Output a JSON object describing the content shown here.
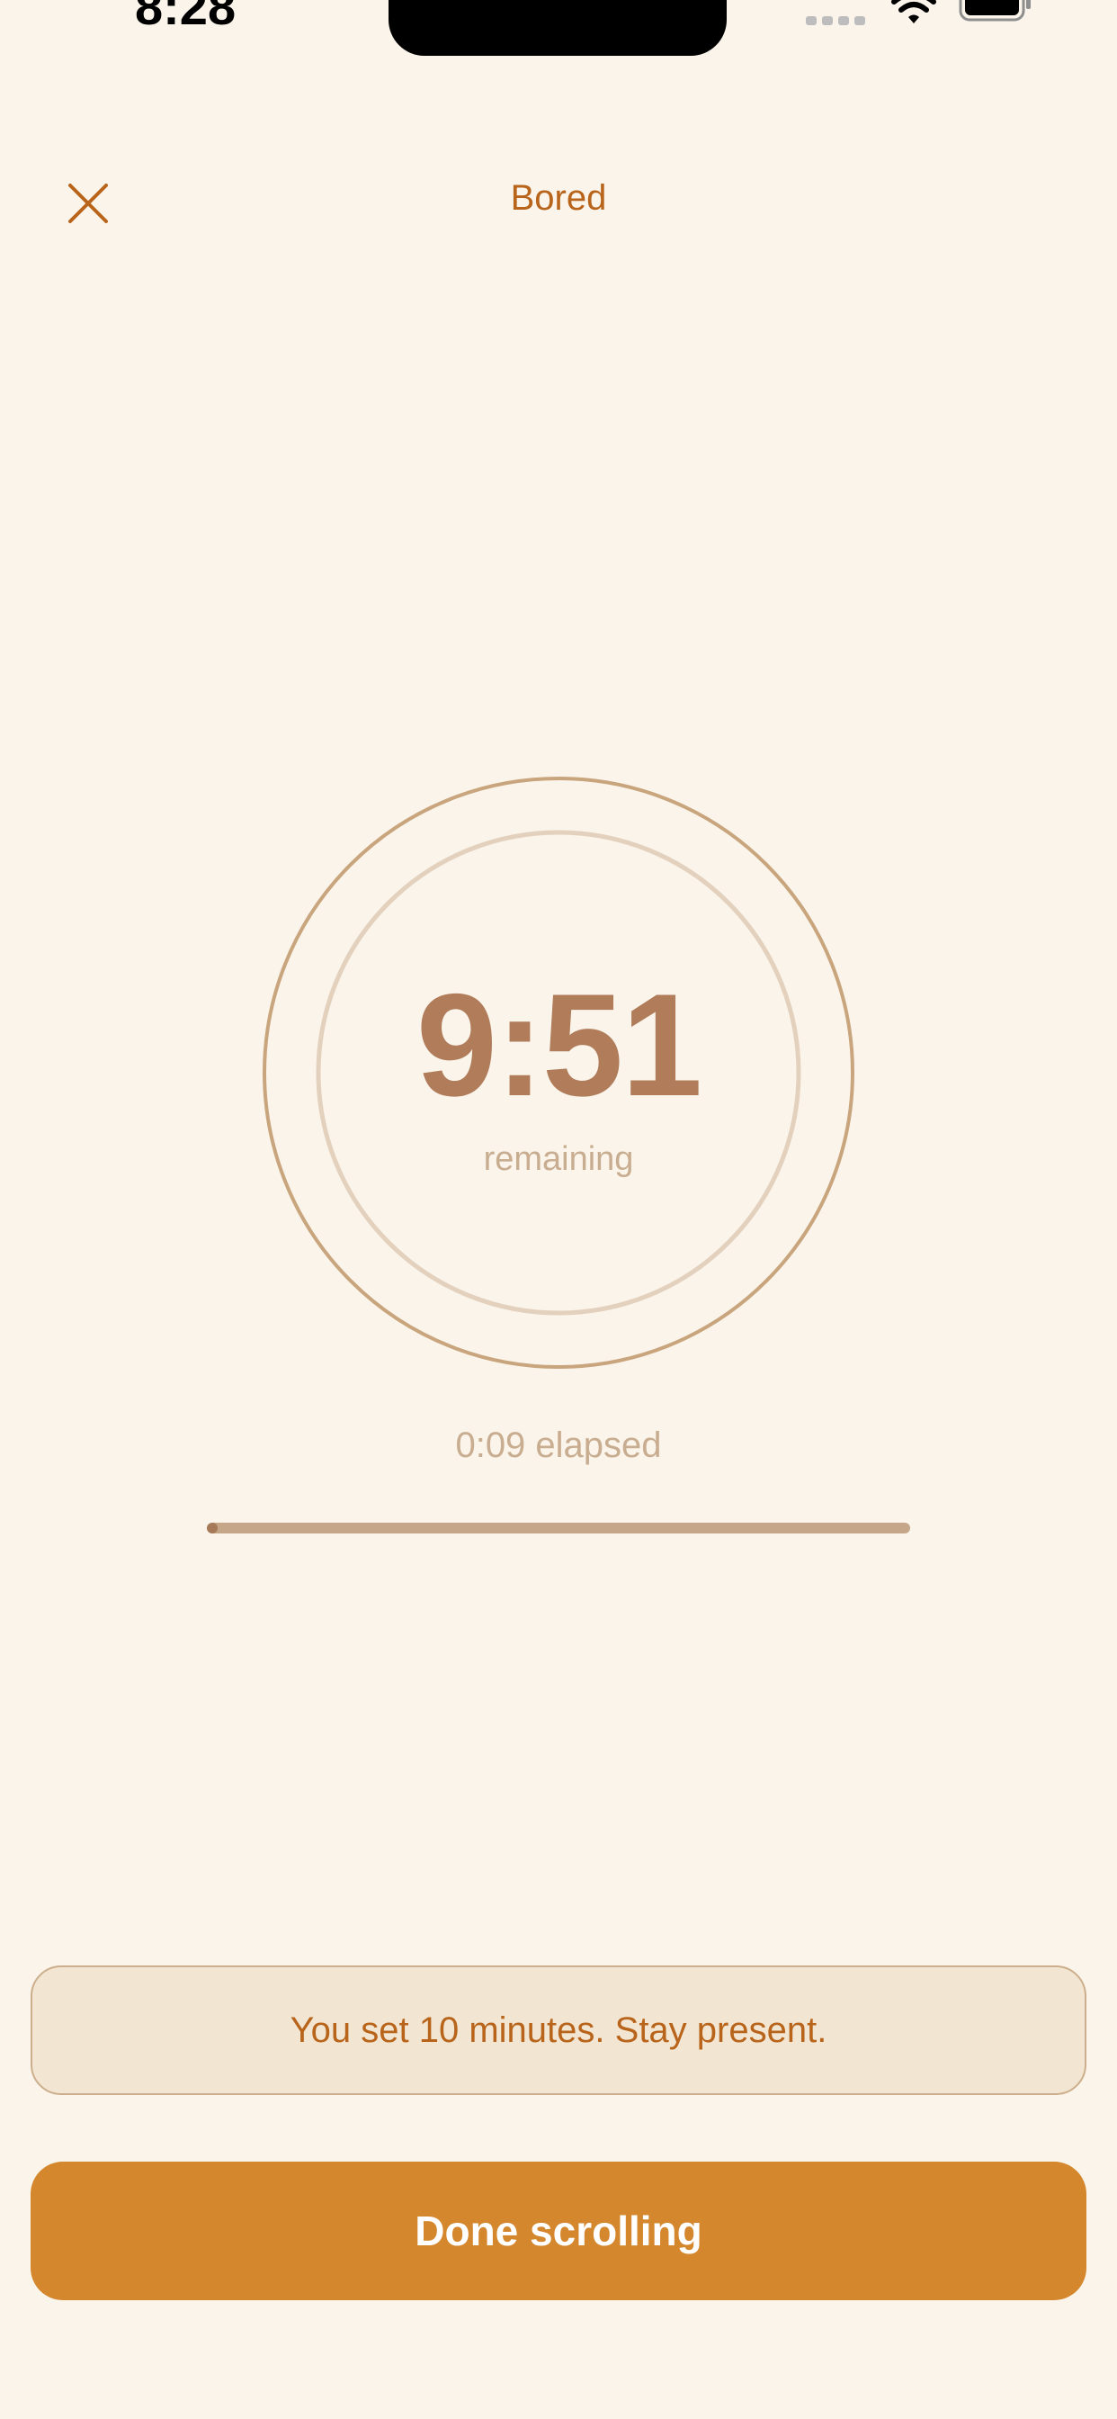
{
  "status_bar": {
    "time": "8:28",
    "icons": [
      "cellular-signal-icon",
      "wifi-icon",
      "battery-icon"
    ]
  },
  "header": {
    "title": "Bored",
    "close_icon": "close-icon"
  },
  "timer": {
    "remaining": "9:51",
    "remaining_caption": "remaining",
    "elapsed": "0:09 elapsed",
    "progress_fraction": 0.015
  },
  "reminder": {
    "text": "You set 10 minutes. Stay present."
  },
  "actions": {
    "done_label": "Done scrolling"
  },
  "colors": {
    "background": "#FAF4EA",
    "accent": "#D4872C",
    "title": "#B8641B",
    "timer_text": "#B07C5A",
    "muted_text": "#C9AD90",
    "outer_ring": "#C9A57E",
    "inner_ring": "#E3D1BE",
    "reminder_bg": "#F2E6D2"
  }
}
